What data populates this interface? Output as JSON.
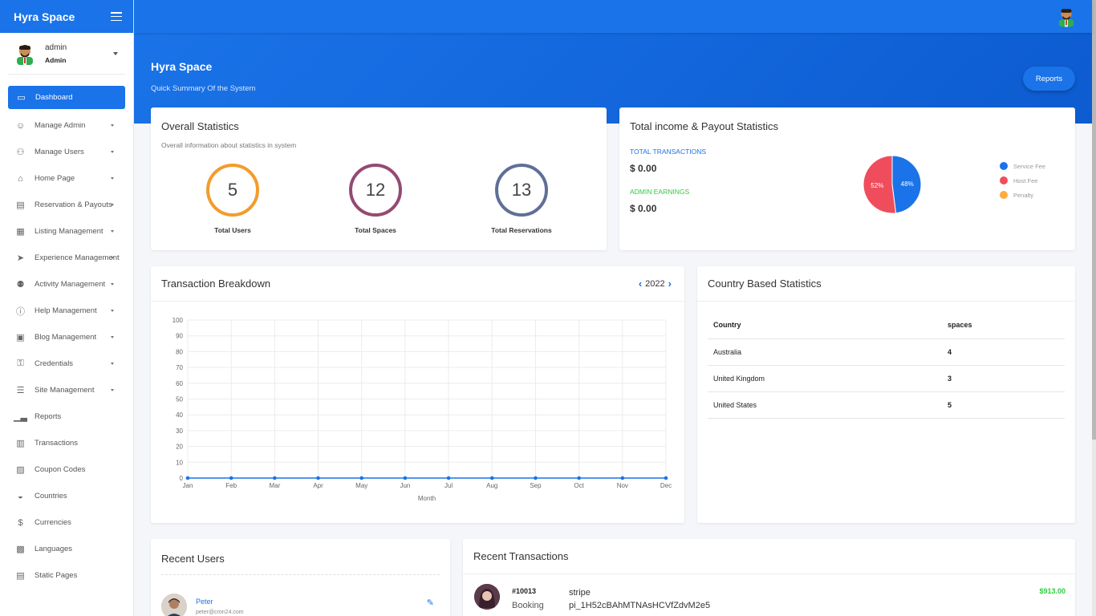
{
  "brand": {
    "name": "Hyra Space"
  },
  "user": {
    "name": "admin",
    "role": "Admin"
  },
  "sidebar": {
    "items": [
      {
        "label": "Dashboard",
        "icon": "monitor-icon",
        "active": true,
        "caret": false
      },
      {
        "label": "Manage Admin",
        "icon": "user-cog-icon",
        "caret": true
      },
      {
        "label": "Manage Users",
        "icon": "users-icon",
        "caret": true
      },
      {
        "label": "Home Page",
        "icon": "home-icon",
        "caret": true
      },
      {
        "label": "Reservation & Payouts",
        "icon": "money-icon",
        "caret": true
      },
      {
        "label": "Listing Management",
        "icon": "building-icon",
        "caret": true
      },
      {
        "label": "Experience Management",
        "icon": "paper-plane-icon",
        "caret": true
      },
      {
        "label": "Activity Management",
        "icon": "group-icon",
        "caret": true
      },
      {
        "label": "Help Management",
        "icon": "help-icon",
        "caret": true
      },
      {
        "label": "Blog Management",
        "icon": "blog-icon",
        "caret": true
      },
      {
        "label": "Credentials",
        "icon": "key-icon",
        "caret": true
      },
      {
        "label": "Site Management",
        "icon": "sliders-icon",
        "caret": true
      },
      {
        "label": "Reports",
        "icon": "bar-chart-icon",
        "caret": false
      },
      {
        "label": "Transactions",
        "icon": "document-icon",
        "caret": false
      },
      {
        "label": "Coupon Codes",
        "icon": "coupon-icon",
        "caret": false
      },
      {
        "label": "Countries",
        "icon": "globe-icon",
        "caret": false
      },
      {
        "label": "Currencies",
        "icon": "dollar-icon",
        "caret": false
      },
      {
        "label": "Languages",
        "icon": "language-icon",
        "caret": false
      },
      {
        "label": "Static Pages",
        "icon": "page-icon",
        "caret": false
      }
    ]
  },
  "header": {
    "title": "Hyra Space",
    "subtitle": "Quick Summary Of the System",
    "reports_button": "Reports"
  },
  "overall": {
    "title": "Overall Statistics",
    "subtitle": "Overall information about statistics in system",
    "stats": [
      {
        "value": "5",
        "label": "Total Users",
        "color": "#f39c2b"
      },
      {
        "value": "12",
        "label": "Total Spaces",
        "color": "#944a72"
      },
      {
        "value": "13",
        "label": "Total Reservations",
        "color": "#5f6f97"
      }
    ]
  },
  "income": {
    "title": "Total income & Payout Statistics",
    "total_transactions_label": "TOTAL TRANSACTIONS",
    "total_transactions_value": "$ 0.00",
    "admin_earnings_label": "ADMIN EARNINGS",
    "admin_earnings_value": "$ 0.00",
    "colors": {
      "transactions": "#1a73e8",
      "earnings": "#2ecc40"
    },
    "pie": [
      {
        "name": "Service Fee",
        "value": 48,
        "label": "48%",
        "color": "#1a73e8"
      },
      {
        "name": "Host Fee",
        "value": 52,
        "label": "52%",
        "color": "#ef4d5c"
      },
      {
        "name": "Penalty",
        "value": 0,
        "label": "",
        "color": "#ffab40"
      }
    ]
  },
  "transactions": {
    "title": "Transaction Breakdown",
    "year": "2022"
  },
  "chart_data": {
    "type": "line",
    "categories": [
      "Jan",
      "Feb",
      "Mar",
      "Apr",
      "May",
      "Jun",
      "Jul",
      "Aug",
      "Sep",
      "Oct",
      "Nov",
      "Dec"
    ],
    "values": [
      0,
      0,
      0,
      0,
      0,
      0,
      0,
      0,
      0,
      0,
      0,
      0
    ],
    "title": "",
    "xlabel": "Month",
    "ylabel": "",
    "ylim": [
      0,
      100
    ],
    "yticks": [
      "0",
      "10",
      "20",
      "30",
      "40",
      "50",
      "60",
      "70",
      "80",
      "90",
      "100"
    ],
    "grid": true,
    "color": "#1a73e8"
  },
  "country": {
    "title": "Country Based Statistics",
    "columns": [
      "Country",
      "spaces"
    ],
    "rows": [
      {
        "country": "Australia",
        "spaces": "4"
      },
      {
        "country": "United Kingdom",
        "spaces": "3"
      },
      {
        "country": "United States",
        "spaces": "5"
      }
    ]
  },
  "recent_users": {
    "title": "Recent Users",
    "items": [
      {
        "name": "Peter",
        "email": "peter@cron24.com"
      }
    ]
  },
  "recent_transactions": {
    "title": "Recent Transactions",
    "items": [
      {
        "id": "#10013",
        "type": "Booking",
        "method": "stripe",
        "ref": "pi_1H52cBAhMTNAsHCVfZdvM2e5",
        "amount": "$913.00"
      }
    ]
  }
}
